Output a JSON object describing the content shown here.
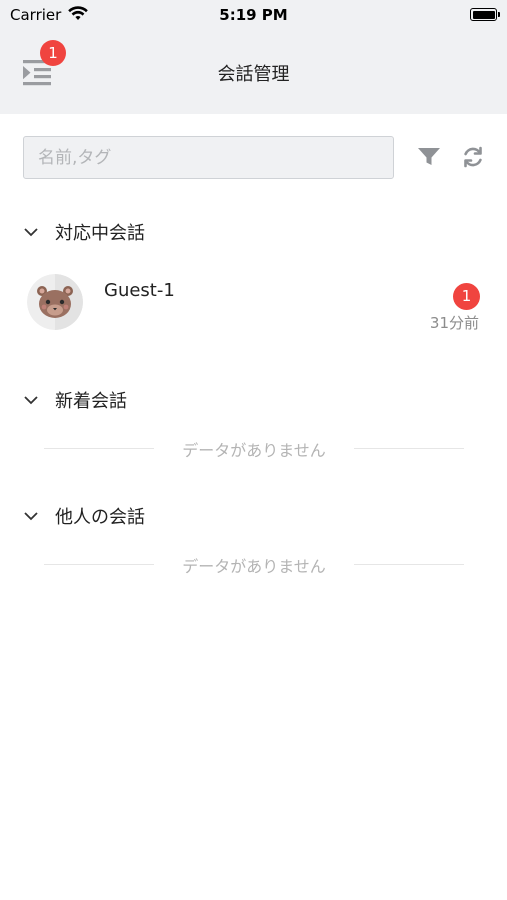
{
  "status_bar": {
    "carrier": "Carrier",
    "time": "5:19 PM"
  },
  "nav": {
    "title": "会話管理",
    "badge": "1"
  },
  "search": {
    "placeholder": "名前,タグ"
  },
  "sections": [
    {
      "title": "対応中会話"
    },
    {
      "title": "新着会話",
      "empty_text": "データがありません"
    },
    {
      "title": "他人の会話",
      "empty_text": "データがありません"
    }
  ],
  "conversation": {
    "name": "Guest-1",
    "unread": "1",
    "time": "31分前"
  },
  "colors": {
    "accent_badge": "#f0443f",
    "nav_bg": "#f0f1f3"
  }
}
